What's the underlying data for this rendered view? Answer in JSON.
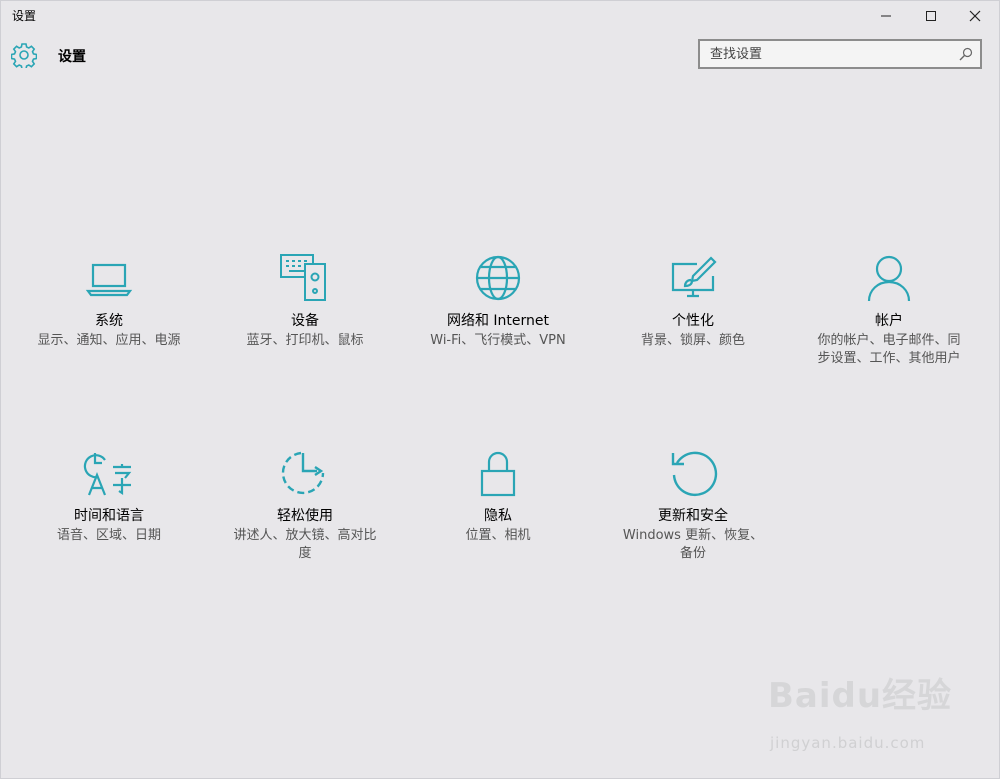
{
  "window": {
    "title": "设置",
    "controls": {
      "minimize": "─",
      "maximize": "☐",
      "close": "✕"
    }
  },
  "header": {
    "title": "设置",
    "search_placeholder": "查找设置",
    "icon": "gear-icon"
  },
  "accent_color": "#2aa5b5",
  "categories": [
    {
      "name": "系统",
      "desc": "显示、通知、应用、电源",
      "icon": "laptop-icon"
    },
    {
      "name": "设备",
      "desc": "蓝牙、打印机、鼠标",
      "icon": "devices-icon"
    },
    {
      "name": "网络和 Internet",
      "desc": "Wi-Fi、飞行模式、VPN",
      "icon": "globe-icon"
    },
    {
      "name": "个性化",
      "desc": "背景、锁屏、颜色",
      "icon": "paint-icon"
    },
    {
      "name": "帐户",
      "desc": "你的帐户、电子邮件、同步设置、工作、其他用户",
      "icon": "person-icon"
    },
    {
      "name": "时间和语言",
      "desc": "语音、区域、日期",
      "icon": "time-language-icon"
    },
    {
      "name": "轻松使用",
      "desc": "讲述人、放大镜、高对比度",
      "icon": "ease-of-access-icon"
    },
    {
      "name": "隐私",
      "desc": "位置、相机",
      "icon": "lock-icon"
    },
    {
      "name": "更新和安全",
      "desc": "Windows 更新、恢复、备份",
      "icon": "update-icon"
    }
  ],
  "watermark": {
    "logo": "Baidu经验",
    "url": "jingyan.baidu.com"
  }
}
